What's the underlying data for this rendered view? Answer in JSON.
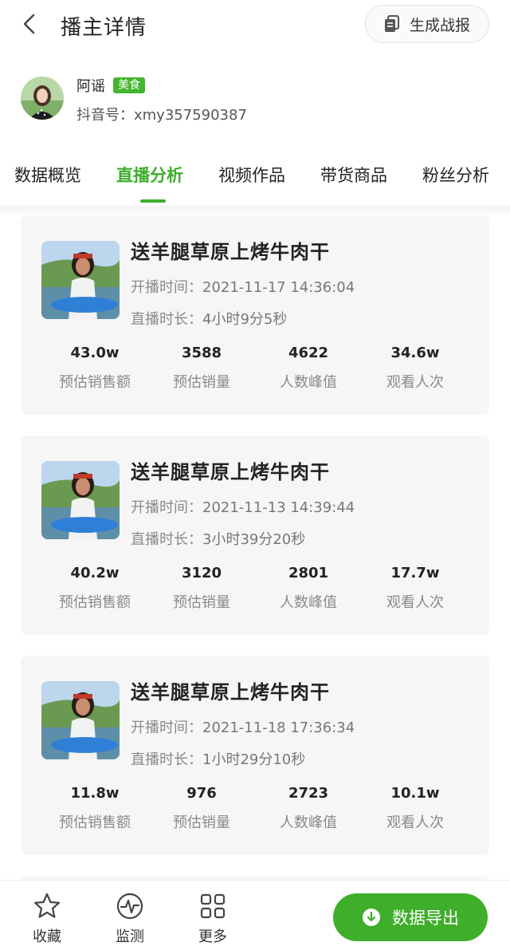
{
  "header": {
    "title": "播主详情",
    "report_button": "生成战报"
  },
  "profile": {
    "name": "阿谣",
    "tag": "美食",
    "account": "抖音号：xmy357590387"
  },
  "tabs": [
    {
      "label": "数据概览",
      "active": false
    },
    {
      "label": "直播分析",
      "active": true
    },
    {
      "label": "视频作品",
      "active": false
    },
    {
      "label": "带货商品",
      "active": false
    },
    {
      "label": "粉丝分析",
      "active": false
    }
  ],
  "cards": [
    {
      "title": "送羊腿草原上烤牛肉干",
      "start_label": "开播时间：",
      "start_time": "2021-11-17 14:36:04",
      "duration_label": "直播时长：",
      "duration": "4小时9分5秒",
      "stats": [
        {
          "value": "43.0w",
          "label": "预估销售额"
        },
        {
          "value": "3588",
          "label": "预估销量"
        },
        {
          "value": "4622",
          "label": "人数峰值"
        },
        {
          "value": "34.6w",
          "label": "观看人次"
        }
      ]
    },
    {
      "title": "送羊腿草原上烤牛肉干",
      "start_label": "开播时间：",
      "start_time": "2021-11-13 14:39:44",
      "duration_label": "直播时长：",
      "duration": "3小时39分20秒",
      "stats": [
        {
          "value": "40.2w",
          "label": "预估销售额"
        },
        {
          "value": "3120",
          "label": "预估销量"
        },
        {
          "value": "2801",
          "label": "人数峰值"
        },
        {
          "value": "17.7w",
          "label": "观看人次"
        }
      ]
    },
    {
      "title": "送羊腿草原上烤牛肉干",
      "start_label": "开播时间：",
      "start_time": "2021-11-18 17:36:34",
      "duration_label": "直播时长：",
      "duration": "1小时29分10秒",
      "stats": [
        {
          "value": "11.8w",
          "label": "预估销售额"
        },
        {
          "value": "976",
          "label": "预估销量"
        },
        {
          "value": "2723",
          "label": "人数峰值"
        },
        {
          "value": "10.1w",
          "label": "观看人次"
        }
      ]
    }
  ],
  "bottom_bar": {
    "favorite": "收藏",
    "monitor": "监测",
    "more": "更多",
    "export": "数据导出"
  },
  "colors": {
    "accent": "#3fae2b",
    "tag_bg": "#44b52e",
    "card_bg": "#f6f6f6"
  },
  "icons": [
    "back-arrow-icon",
    "document-icon",
    "star-icon",
    "pulse-icon",
    "grid-icon",
    "download-icon"
  ]
}
